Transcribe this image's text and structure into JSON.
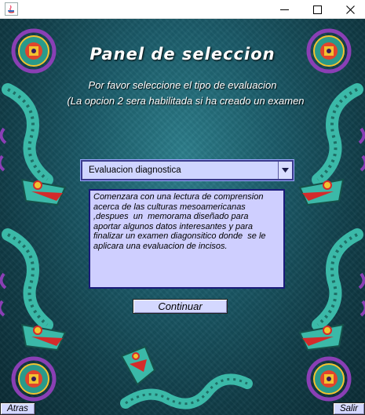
{
  "window": {
    "controls": {
      "minimize": "minimize-icon",
      "maximize": "maximize-icon",
      "close": "close-icon"
    },
    "icon": "java-app-icon"
  },
  "panel": {
    "title": "Panel de seleccion",
    "instruction_line1": "Por favor seleccione el tipo de evaluacion",
    "instruction_line2": "(La opcion 2 sera habilitada si ha creado un examen"
  },
  "evaluation_select": {
    "selected": "Evaluacion diagnostica"
  },
  "description": {
    "text": "Comenzara con una lectura de comprension\nacerca de las culturas mesoamericanas\n,despues  un  memorama diseñado para\naportar algunos datos interesantes y para\nfinalizar un examen diagonsitico donde  se le\naplicara una evaluacion de incisos."
  },
  "buttons": {
    "continue_label": "Continuar",
    "back_label": "Atras",
    "exit_label": "Salir"
  },
  "colors": {
    "background": "#1c5c6a",
    "combo_fill": "#cfd5ff",
    "textarea_fill": "#cfcfff",
    "button_fill": "#d4d8ff",
    "serpent": "#3bb9a8",
    "serpent_mouth": "#d42b2b",
    "feather": "#8a3fb5"
  },
  "decorations": {
    "corner_medallions": "aztec-sun-medallion-icon",
    "serpents": "feathered-serpent-icon"
  }
}
